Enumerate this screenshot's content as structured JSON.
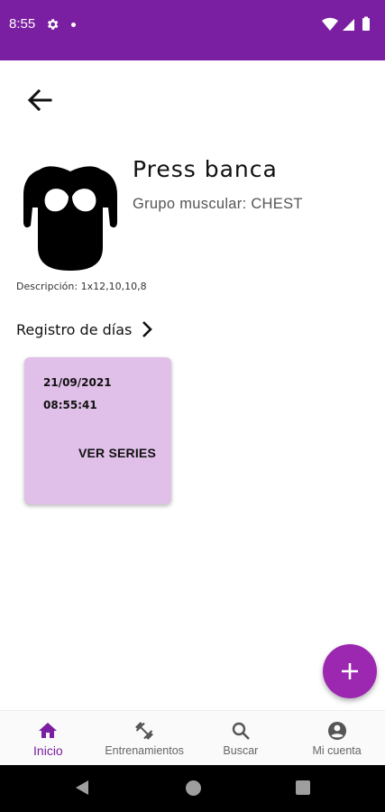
{
  "status_bar": {
    "time": "8:55",
    "color": "#7b1fa2",
    "icons": [
      "gear-icon",
      "notification-dot",
      "wifi-icon",
      "signal-icon",
      "battery-icon"
    ]
  },
  "header": {
    "back_icon": "arrow-left-icon"
  },
  "exercise": {
    "image_icon": "chest-muscle-icon",
    "title": "Press banca",
    "group": "Grupo muscular: CHEST",
    "description": "Descripción: 1x12,10,10,8"
  },
  "registro": {
    "label": "Registro de días",
    "chevron_icon": "chevron-right-icon"
  },
  "days": [
    {
      "date": "21/09/2021",
      "time": "08:55:41",
      "button_label": "VER SERIES"
    }
  ],
  "card_color": "#e0bfe8",
  "fab": {
    "icon": "plus-icon",
    "color": "#9c27b0"
  },
  "bottom_nav": {
    "items": [
      {
        "label": "Inicio",
        "icon": "home-icon",
        "active": true
      },
      {
        "label": "Entrenamientos",
        "icon": "dumbbell-icon",
        "active": false
      },
      {
        "label": "Buscar",
        "icon": "search-icon",
        "active": false
      },
      {
        "label": "Mi cuenta",
        "icon": "account-icon",
        "active": false
      }
    ],
    "active_color": "#7b1fa2"
  },
  "system_nav": {
    "icons": [
      "back-triangle-icon",
      "home-circle-icon",
      "recents-square-icon"
    ]
  }
}
